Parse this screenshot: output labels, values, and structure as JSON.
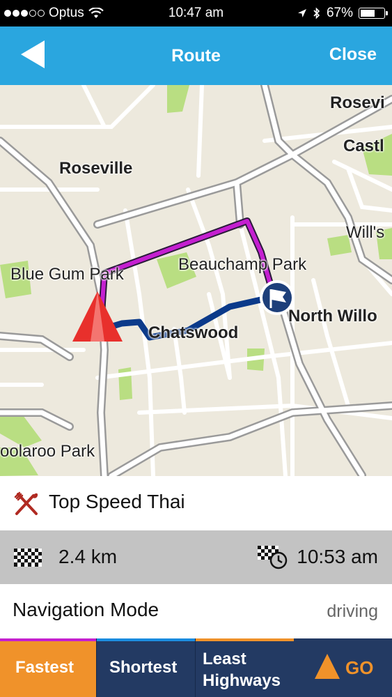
{
  "status_bar": {
    "carrier": "Optus",
    "time": "10:47 am",
    "battery": "67%",
    "battery_level": 0.67
  },
  "nav": {
    "title": "Route",
    "close_label": "Close"
  },
  "map": {
    "labels": {
      "roseville_top": "Rosevi",
      "castle": "Castl",
      "roseville": "Roseville",
      "wills": "Will's",
      "blue_gum_park": "Blue Gum Park",
      "beauchamp_park": "Beauchamp Park",
      "north_willoughby": "North Willo",
      "chatswood": "Chatswood",
      "oolaroo_park": "oolaroo Park"
    },
    "colors": {
      "fastest_route": "#c41fd0",
      "shortest_route": "#0b3a8a",
      "destination_marker": "#1d3f7a",
      "current_position": "#e8302c"
    }
  },
  "destination": {
    "icon": "restaurant-icon",
    "name": "Top Speed Thai"
  },
  "stats": {
    "distance": "2.4 km",
    "arrival": "10:53 am"
  },
  "mode": {
    "label": "Navigation Mode",
    "value": "driving"
  },
  "route_options": {
    "fastest": "Fastest",
    "shortest": "Shortest",
    "least_highways": "Least Highways",
    "go": "GO"
  },
  "colors": {
    "accent": "#2aa6df",
    "selected_option": "#f0922a",
    "bottom_bar": "#233a63"
  }
}
